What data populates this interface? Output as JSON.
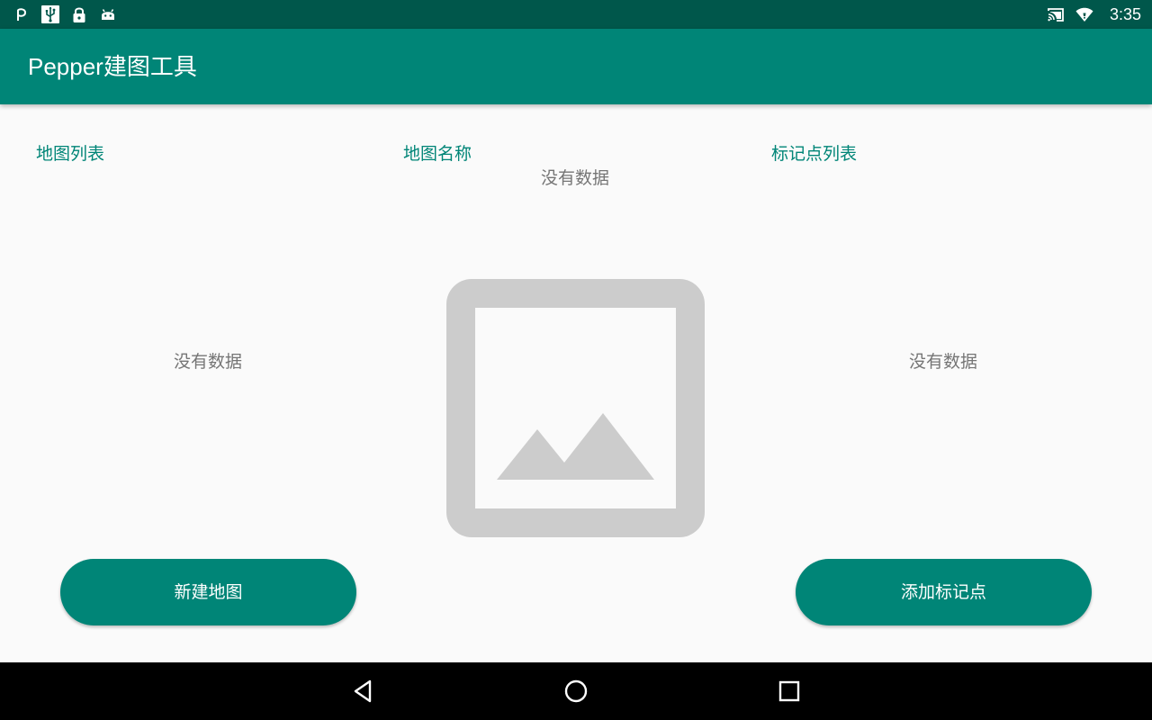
{
  "status_bar": {
    "time": "3:35",
    "left_icons": [
      "pepper-p-icon",
      "usb-icon",
      "lock-icon",
      "android-icon"
    ],
    "right_icons": [
      "cast-icon",
      "wifi-icon"
    ]
  },
  "app_bar": {
    "title": "Pepper建图工具"
  },
  "map_list": {
    "header": "地图列表",
    "empty_text": "没有数据"
  },
  "map_name": {
    "header": "地图名称",
    "empty_text": "没有数据",
    "image_icon": "image-placeholder-icon"
  },
  "marker_list": {
    "header": "标记点列表",
    "empty_text": "没有数据"
  },
  "buttons": {
    "new_map": "新建地图",
    "add_marker": "添加标记点"
  },
  "nav_bar": {
    "icons": [
      "back-icon",
      "home-icon",
      "recents-icon"
    ]
  },
  "colors": {
    "status_bar": "#00574b",
    "primary": "#008577",
    "background": "#fafafa",
    "empty_text": "#757575",
    "placeholder": "#cccccc",
    "nav_bar": "#000000"
  }
}
